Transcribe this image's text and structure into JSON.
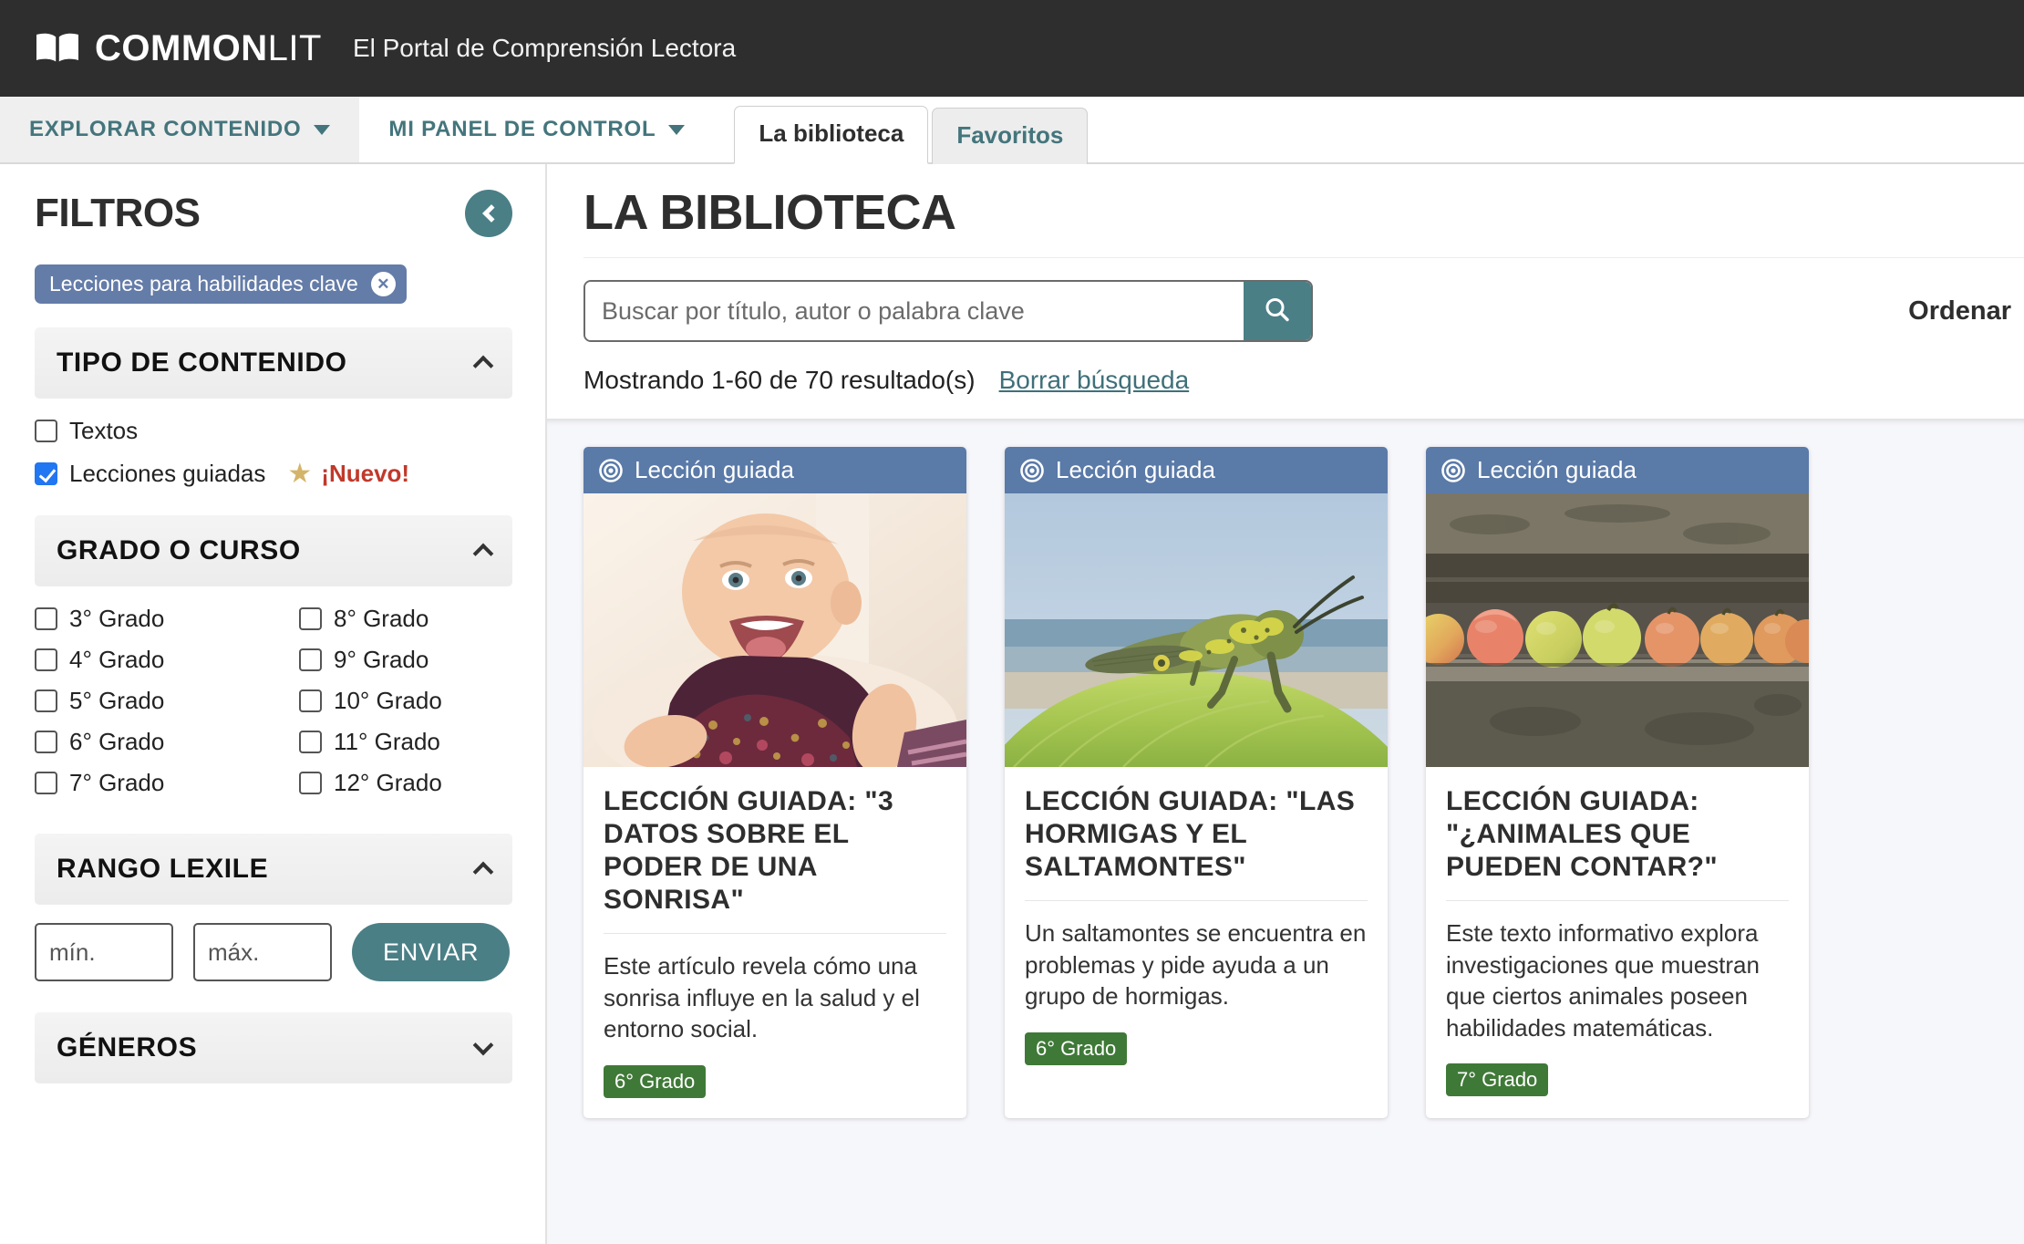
{
  "header": {
    "logo_bold": "COMMON",
    "logo_light": "LIT",
    "tagline": "El Portal de Comprensión Lectora",
    "book_icon": "open-book-icon"
  },
  "nav": {
    "items": [
      {
        "label": "EXPLORAR CONTENIDO",
        "has_caret": true,
        "active": true
      },
      {
        "label": "MI PANEL DE CONTROL",
        "has_caret": true,
        "active": false
      }
    ],
    "tabs": [
      {
        "label": "La biblioteca",
        "selected": true
      },
      {
        "label": "Favoritos",
        "selected": false
      }
    ]
  },
  "sidebar": {
    "title": "FILTROS",
    "collapse_icon": "chevron-left-icon",
    "active_filter_chip": {
      "label": "Lecciones para habilidades clave",
      "remove_icon": "close-icon",
      "color": "#647ca8"
    },
    "sections": [
      {
        "title": "TIPO DE CONTENIDO",
        "expanded": true,
        "chevron": "chevron-up-icon",
        "options": [
          {
            "label": "Textos",
            "checked": false
          },
          {
            "label": "Lecciones guiadas",
            "checked": true,
            "badge_icon": "star-icon",
            "badge_label": "¡Nuevo!"
          }
        ]
      },
      {
        "title": "GRADO O CURSO",
        "expanded": true,
        "chevron": "chevron-up-icon",
        "options": [
          {
            "label": "3° Grado",
            "checked": false
          },
          {
            "label": "4° Grado",
            "checked": false
          },
          {
            "label": "5° Grado",
            "checked": false
          },
          {
            "label": "6° Grado",
            "checked": false
          },
          {
            "label": "7° Grado",
            "checked": false
          },
          {
            "label": "8° Grado",
            "checked": false
          },
          {
            "label": "9° Grado",
            "checked": false
          },
          {
            "label": "10° Grado",
            "checked": false
          },
          {
            "label": "11° Grado",
            "checked": false
          },
          {
            "label": "12° Grado",
            "checked": false
          }
        ]
      },
      {
        "title": "RANGO LEXILE",
        "expanded": true,
        "chevron": "chevron-up-icon",
        "min_placeholder": "mín.",
        "max_placeholder": "máx.",
        "min_value": "",
        "max_value": "",
        "submit_label": "ENVIAR"
      },
      {
        "title": "GÉNEROS",
        "expanded": false,
        "chevron": "chevron-down-icon"
      }
    ]
  },
  "main": {
    "page_title": "LA BIBLIOTECA",
    "search": {
      "placeholder": "Buscar por título, autor o palabra clave",
      "value": "",
      "button_icon": "search-icon"
    },
    "sort_label": "Ordenar",
    "results_count_text": "Mostrando 1-60 de 70 resultado(s)",
    "clear_search_label": "Borrar búsqueda",
    "cards": [
      {
        "ribbon_label": "Lección guiada",
        "ribbon_icon": "target-icon",
        "title": "LECCIÓN GUIADA: \"3 DATOS SOBRE EL PODER DE UNA SONRISA\"",
        "description": "Este artículo revela cómo una sonrisa influye en la salud y el entorno social.",
        "grade_badge": "6° Grado",
        "image_alt": "smiling-baby-photo"
      },
      {
        "ribbon_label": "Lección guiada",
        "ribbon_icon": "target-icon",
        "title": "LECCIÓN GUIADA: \"LAS HORMIGAS Y EL SALTAMONTES\"",
        "description": "Un saltamontes se encuentra en problemas y pide ayuda a un grupo de hormigas.",
        "grade_badge": "6° Grado",
        "image_alt": "grasshopper-on-leaf-photo"
      },
      {
        "ribbon_label": "Lección guiada",
        "ribbon_icon": "target-icon",
        "title": "LECCIÓN GUIADA: \"¿ANIMALES QUE PUEDEN CONTAR?\"",
        "description": "Este texto informativo explora investigaciones que muestran que ciertos animales poseen habilidades matemáticas.",
        "grade_badge": "7° Grado",
        "image_alt": "apples-on-stone-step-photo"
      }
    ]
  },
  "colors": {
    "header_bg": "#2e2e2e",
    "teal": "#4a7f86",
    "chip_blue": "#647ca8",
    "ribbon_blue": "#5a7aa8",
    "grade_green": "#3f7937",
    "new_red": "#c0392b",
    "star_gold": "#d4b46a",
    "results_bg": "#f6f7fb",
    "checkbox_blue": "#2176f2"
  }
}
